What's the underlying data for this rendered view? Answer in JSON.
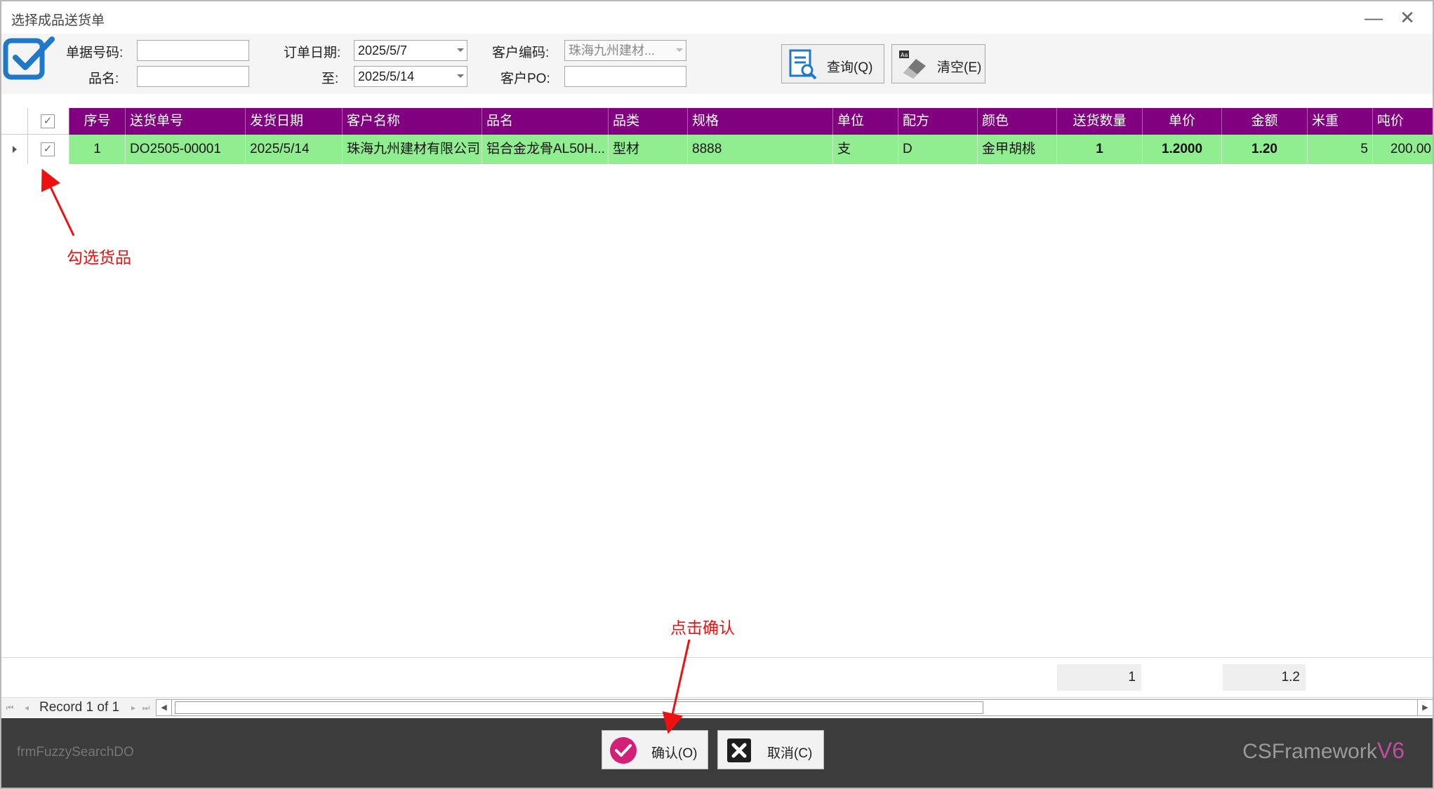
{
  "window": {
    "title": "选择成品送货单",
    "minimize_glyph": "—",
    "close_glyph": "✕"
  },
  "filters": {
    "doc_no_label": "单据号码:",
    "doc_no_value": "",
    "product_label": "品名:",
    "product_value": "",
    "order_date_label": "订单日期:",
    "order_date_from": "2025/5/7",
    "to_label": "至:",
    "order_date_to": "2025/5/14",
    "customer_code_label": "客户编码:",
    "customer_code_value": "珠海九州建材...",
    "customer_po_label": "客户PO:",
    "customer_po_value": ""
  },
  "toolbar": {
    "query_label": "查询(Q)",
    "clear_label": "清空(E)"
  },
  "grid": {
    "header_checkbox": "✓",
    "columns": [
      "序号",
      "送货单号",
      "发货日期",
      "客户名称",
      "品名",
      "品类",
      "规格",
      "单位",
      "配方",
      "颜色",
      "送货数量",
      "单价",
      "金额",
      "米重",
      "吨价"
    ],
    "rows": [
      {
        "checked": "✓",
        "cells": [
          "1",
          "DO2505-00001",
          "2025/5/14",
          "珠海九州建材有限公司",
          "铝合金龙骨AL50H...",
          "型材",
          "8888",
          "支",
          "D",
          "金甲胡桃",
          "1",
          "1.2000",
          "1.20",
          "5",
          "200.00"
        ]
      }
    ],
    "row_color": "#90ee90",
    "header_color": "#800080"
  },
  "summary": {
    "qty_total": "1",
    "amount_total": "1.2"
  },
  "navigator": {
    "record_text": "Record 1 of 1"
  },
  "bottom": {
    "form_name": "frmFuzzySearchDO",
    "confirm_label": "确认(O)",
    "cancel_label": "取消(C)",
    "brand_text": "CSFramework",
    "brand_version": "V6"
  },
  "annotations": {
    "select_goods": "勾选货品",
    "click_confirm": "点击确认"
  }
}
